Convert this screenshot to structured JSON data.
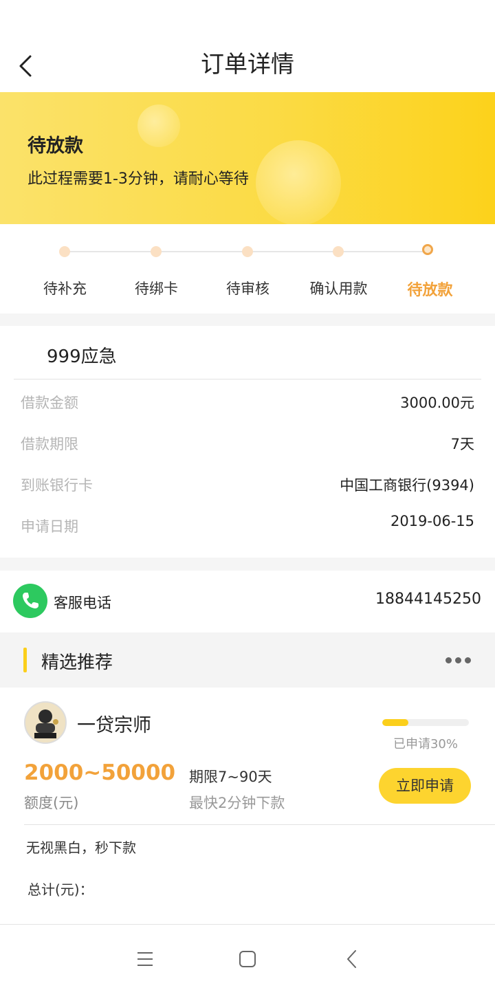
{
  "header": {
    "title": "订单详情"
  },
  "banner": {
    "status": "待放款",
    "desc": "此过程需要1-3分钟，请耐心等待"
  },
  "steps": [
    {
      "label": "待补充",
      "active": false
    },
    {
      "label": "待绑卡",
      "active": false
    },
    {
      "label": "待审核",
      "active": false
    },
    {
      "label": "确认用款",
      "active": false
    },
    {
      "label": "待放款",
      "active": true
    }
  ],
  "order": {
    "product": "999应急",
    "rows": [
      {
        "key": "借款金额",
        "value": "3000.00元"
      },
      {
        "key": "借款期限",
        "value": "7天"
      },
      {
        "key": "到账银行卡",
        "value": "中国工商银行(9394)"
      },
      {
        "key": "申请日期",
        "value": "2019-06-15"
      }
    ]
  },
  "service": {
    "label": "客服电话",
    "phone": "18844145250"
  },
  "recommend": {
    "title": "精选推荐",
    "lender": {
      "name": "一贷宗师",
      "progress_text": "已申请30%",
      "progress_percent": 30,
      "amount": "2000~50000",
      "amount_label": "额度(元)",
      "term": "期限7~90天",
      "speed": "最快2分钟下款",
      "apply_label": "立即申请",
      "slogan": "无视黑白，秒下款",
      "total": "总计(元)："
    }
  },
  "colors": {
    "accent": "#fbcf1b",
    "orange": "#f2a23a",
    "green": "#2dc95f"
  }
}
